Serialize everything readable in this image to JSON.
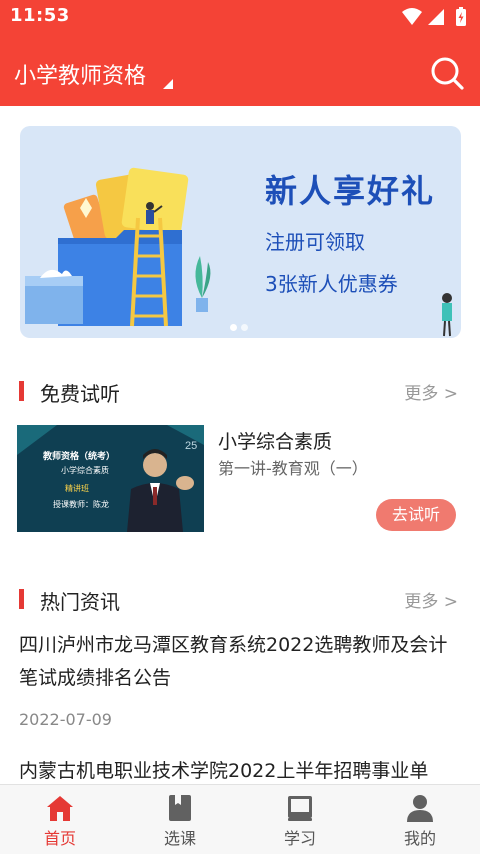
{
  "status_bar": {
    "time": "11:53"
  },
  "app_bar": {
    "title": "小学教师资格"
  },
  "banner": {
    "title": "新人享好礼",
    "line1": "注册可领取",
    "line2": "3张新人优惠券"
  },
  "free_trial": {
    "section_title": "免费试听",
    "more_label": "更多 >",
    "course": {
      "thumb_title": "教师资格（统考）",
      "thumb_subject": "小学综合素质",
      "thumb_tag": "精讲班",
      "thumb_teacher": "授课教师：陈龙",
      "title": "小学综合素质",
      "subtitle": "第一讲-教育观（一）",
      "button_label": "去试听"
    }
  },
  "hot_news": {
    "section_title": "热门资讯",
    "more_label": "更多 >",
    "items": [
      {
        "title": "四川泸州市龙马潭区教育系统2022选聘教师及会计笔试成绩排名公告",
        "date": "2022-07-09"
      },
      {
        "title": "内蒙古机电职业技术学院2022上半年招聘事业单",
        "date": ""
      }
    ]
  },
  "bottom_nav": {
    "items": [
      {
        "label": "首页",
        "icon": "home-icon"
      },
      {
        "label": "选课",
        "icon": "book-icon"
      },
      {
        "label": "学习",
        "icon": "open-book-icon"
      },
      {
        "label": "我的",
        "icon": "person-icon"
      }
    ],
    "active_index": 0
  },
  "colors": {
    "primary": "#f44336",
    "accent": "#e53935",
    "banner_text": "#1d4fb8",
    "trial_button": "#f07a6f"
  }
}
